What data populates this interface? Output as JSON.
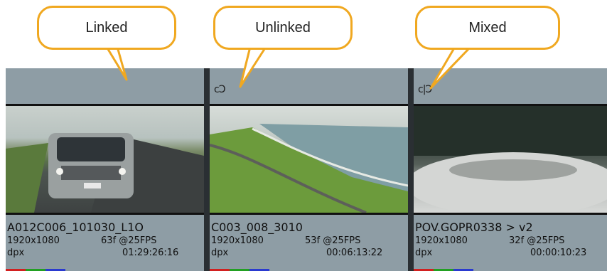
{
  "callouts": {
    "linked": "Linked",
    "unlinked": "Unlinked",
    "mixed": "Mixed"
  },
  "clips": [
    {
      "link_icon": "",
      "name": "A012C006_101030_L1O",
      "resolution": "1920x1080",
      "frames": "63f @25FPS",
      "format": "dpx",
      "timecode": "01:29:26:16"
    },
    {
      "link_icon": "cↃ",
      "name": "C003_008_3010",
      "resolution": "1920x1080",
      "frames": "53f @25FPS",
      "format": "dpx",
      "timecode": "00:06:13:22"
    },
    {
      "link_icon": "c|Ↄ",
      "name": "POV.GOPR0338 > v2",
      "resolution": "1920x1080",
      "frames": "32f @25FPS",
      "format": "dpx",
      "timecode": "00:00:10:23"
    }
  ],
  "colors": {
    "callout_border": "#f0a820",
    "clip_background": "#8e9da5",
    "channel_red": "#d22020",
    "channel_green": "#22a022",
    "channel_blue": "#2a3ad0"
  }
}
